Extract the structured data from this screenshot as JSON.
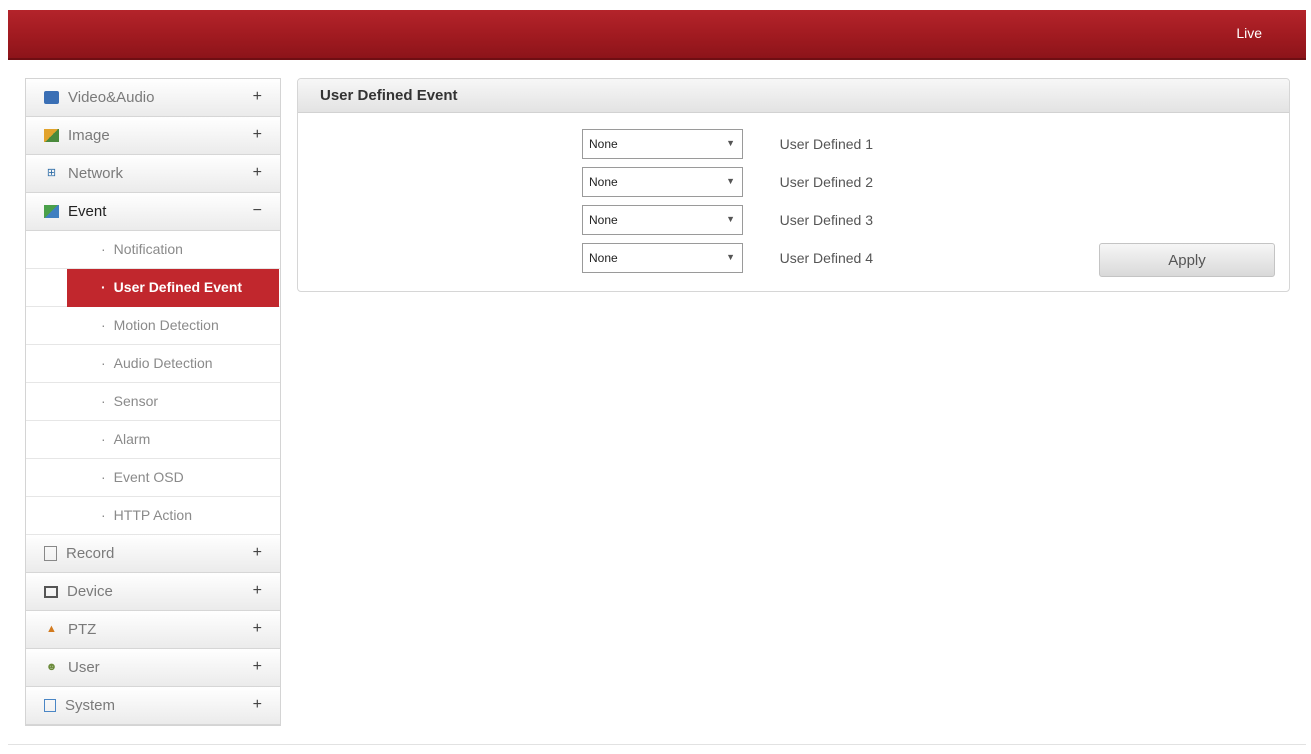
{
  "header": {
    "live_label": "Live"
  },
  "sidebar": {
    "categories_top": [
      {
        "label": "Video&Audio",
        "sign": "+",
        "icon": "video-audio-icon"
      },
      {
        "label": "Image",
        "sign": "+",
        "icon": "image-icon"
      },
      {
        "label": "Network",
        "sign": "+",
        "icon": "network-icon"
      },
      {
        "label": "Event",
        "sign": "−",
        "icon": "event-icon"
      }
    ],
    "event_items": [
      {
        "label": "Notification"
      },
      {
        "label": "User Defined Event"
      },
      {
        "label": "Motion Detection"
      },
      {
        "label": "Audio Detection"
      },
      {
        "label": "Sensor"
      },
      {
        "label": "Alarm"
      },
      {
        "label": "Event OSD"
      },
      {
        "label": "HTTP Action"
      }
    ],
    "categories_bottom": [
      {
        "label": "Record",
        "sign": "+",
        "icon": "record-icon"
      },
      {
        "label": "Device",
        "sign": "+",
        "icon": "device-icon"
      },
      {
        "label": "PTZ",
        "sign": "+",
        "icon": "ptz-icon"
      },
      {
        "label": "User",
        "sign": "+",
        "icon": "user-icon"
      },
      {
        "label": "System",
        "sign": "+",
        "icon": "system-icon"
      }
    ],
    "active_item": "User Defined Event"
  },
  "main": {
    "title": "User Defined Event",
    "rows": [
      {
        "label": "User Defined 1",
        "value": "None"
      },
      {
        "label": "User Defined 2",
        "value": "None"
      },
      {
        "label": "User Defined 3",
        "value": "None"
      },
      {
        "label": "User Defined 4",
        "value": "None"
      }
    ],
    "apply_label": "Apply"
  },
  "colors": {
    "brand_red": "#b4242b",
    "active_item": "#c1272d"
  }
}
